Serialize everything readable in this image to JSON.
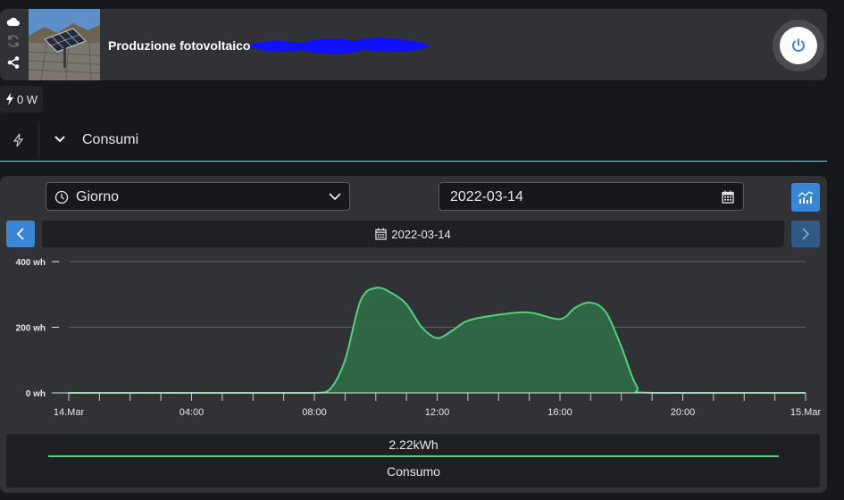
{
  "header": {
    "title": "Produzione fotovoltaico",
    "side_icons": [
      "cloud-icon",
      "sync-icon",
      "share-icon"
    ]
  },
  "power_badge": {
    "value": "0 W"
  },
  "section": {
    "label": "Consumi"
  },
  "controls": {
    "period": "Giorno",
    "date_input": "2022-03-14",
    "current_date": "2022-03-14"
  },
  "colors": {
    "accent": "#3a86d6",
    "series_line": "#4fd37b",
    "series_fill": "#2f6a48",
    "panel": "#303236",
    "background": "#17181b"
  },
  "chart_data": {
    "type": "area",
    "ylabel_unit": "wh",
    "y_ticks": [
      "0 wh",
      "200 wh",
      "400 wh"
    ],
    "ylim": [
      0,
      400
    ],
    "x_tick_labels": [
      "14.Mar",
      "04:00",
      "08:00",
      "12:00",
      "16:00",
      "20:00",
      "15.Mar"
    ],
    "x_range_hours": [
      0,
      24
    ],
    "grid": true,
    "series": [
      {
        "name": "Consumo",
        "x": [
          "00:00",
          "06:00",
          "08:00",
          "08:30",
          "09:00",
          "09:30",
          "10:00",
          "10:30",
          "11:00",
          "11:30",
          "12:00",
          "12:30",
          "13:00",
          "14:00",
          "15:00",
          "16:00",
          "16:30",
          "17:00",
          "17:30",
          "18:00",
          "18:30",
          "19:00",
          "24:00"
        ],
        "values": [
          0,
          0,
          0,
          10,
          100,
          280,
          320,
          305,
          270,
          200,
          167,
          190,
          220,
          238,
          245,
          225,
          260,
          275,
          245,
          140,
          20,
          0,
          0
        ]
      }
    ]
  },
  "summary": {
    "total": "2.22kWh",
    "label": "Consumo"
  }
}
